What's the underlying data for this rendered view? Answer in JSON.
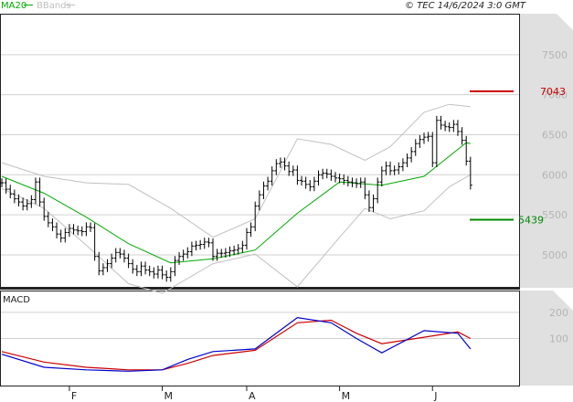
{
  "header": {
    "legend_ma": "MA20",
    "legend_bb": "BBands",
    "copyright": "© TEC 14/6/2024 3:0 GMT"
  },
  "macd": {
    "label": "MACD"
  },
  "levels": {
    "resistance": {
      "label": "7043",
      "value": 7043,
      "color": "#cc0000"
    },
    "support": {
      "label": "5439",
      "value": 5439,
      "color": "#008800"
    }
  },
  "colors": {
    "ma": "#00aa00",
    "bbands": "#c0c0c0",
    "macd_line": "#0000cc",
    "signal_line": "#cc0000",
    "candle": "#000000"
  },
  "chart_data": [
    {
      "type": "ohlc",
      "title": "",
      "ylim": [
        4600,
        8000
      ],
      "yticks": [
        "5000",
        "5500",
        "6000",
        "6500",
        "7000",
        "7500"
      ],
      "xticks": [
        "F",
        "M",
        "A",
        "M",
        "J"
      ],
      "closes": [
        5900,
        5820,
        5760,
        5700,
        5660,
        5610,
        5640,
        5690,
        5910,
        5660,
        5480,
        5400,
        5350,
        5260,
        5210,
        5280,
        5330,
        5310,
        5300,
        5290,
        5350,
        5340,
        4980,
        4800,
        4840,
        4890,
        4960,
        5030,
        5010,
        4960,
        4890,
        4820,
        4790,
        4860,
        4810,
        4790,
        4760,
        4810,
        4750,
        4720,
        4790,
        4930,
        4980,
        5010,
        5040,
        5110,
        5120,
        5130,
        5160,
        5150,
        4980,
        5020,
        5020,
        5030,
        5050,
        5060,
        5080,
        5120,
        5280,
        5350,
        5610,
        5750,
        5860,
        5920,
        6050,
        6140,
        6160,
        6110,
        6040,
        6060,
        5930,
        5920,
        5880,
        5850,
        5920,
        6000,
        6020,
        6010,
        5980,
        5960,
        5950,
        5930,
        5910,
        5900,
        5890,
        5910,
        5750,
        5590,
        5700,
        5910,
        6050,
        6110,
        6050,
        6060,
        6100,
        6150,
        6210,
        6290,
        6390,
        6440,
        6470,
        6480,
        6150,
        6680,
        6620,
        6600,
        6590,
        6630,
        6540,
        6430,
        6170,
        5870
      ],
      "ma20": {
        "x": [
          0,
          10,
          20,
          30,
          40,
          50,
          60,
          70,
          80,
          90,
          100,
          110,
          111
        ],
        "y": [
          5980,
          5770,
          5470,
          5140,
          4900,
          4950,
          5060,
          5520,
          5910,
          5870,
          5980,
          6400,
          6390
        ]
      },
      "bb_upper": {
        "x": [
          0,
          10,
          20,
          30,
          40,
          50,
          60,
          70,
          78,
          86,
          92,
          100,
          106,
          111
        ],
        "y": [
          6150,
          5980,
          5900,
          5880,
          5580,
          5220,
          5450,
          6450,
          6380,
          6180,
          6350,
          6780,
          6880,
          6850
        ]
      },
      "bb_lower": {
        "x": [
          0,
          10,
          20,
          30,
          38,
          50,
          60,
          70,
          80,
          86,
          92,
          100,
          106,
          111
        ],
        "y": [
          5830,
          5580,
          5120,
          4640,
          4520,
          4890,
          5010,
          4600,
          5220,
          5580,
          5450,
          5550,
          5850,
          6000
        ]
      }
    },
    {
      "type": "line",
      "title": "",
      "ylim": [
        -80,
        280
      ],
      "yticks": [
        "100",
        "200"
      ],
      "series": [
        {
          "role": "macd",
          "x": [
            0,
            10,
            20,
            30,
            38,
            44,
            50,
            60,
            70,
            78,
            84,
            90,
            100,
            108,
            111
          ],
          "y": [
            40,
            -10,
            -20,
            -25,
            -20,
            20,
            50,
            60,
            180,
            160,
            100,
            45,
            130,
            120,
            60
          ]
        },
        {
          "role": "signal",
          "x": [
            0,
            10,
            20,
            30,
            38,
            44,
            50,
            60,
            70,
            78,
            84,
            90,
            100,
            108,
            111
          ],
          "y": [
            50,
            10,
            -10,
            -20,
            -20,
            5,
            35,
            55,
            160,
            170,
            120,
            80,
            105,
            125,
            100
          ]
        }
      ]
    }
  ]
}
